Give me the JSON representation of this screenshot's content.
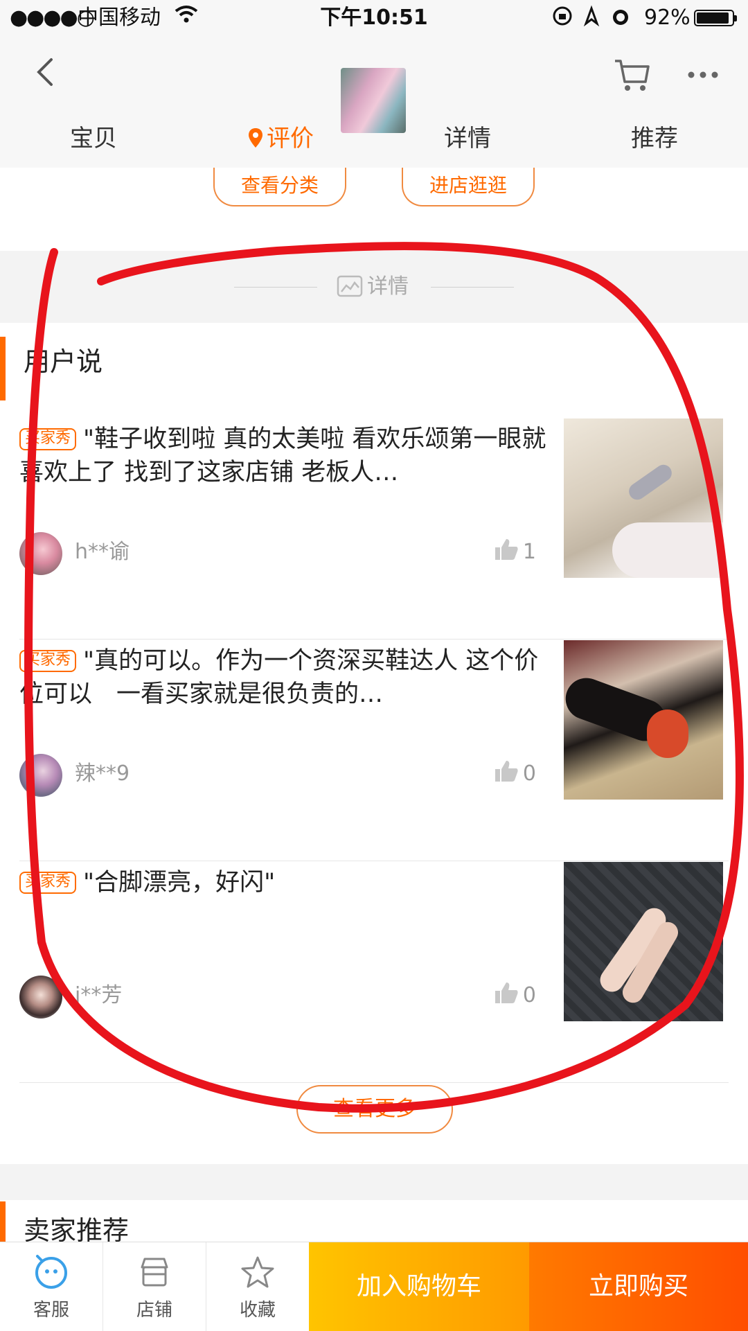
{
  "status_bar": {
    "signal": "●●●●○",
    "carrier": "中国移动",
    "time": "下午10:51",
    "battery": "92%",
    "battery_level": 0.92
  },
  "nav": {
    "tabs": [
      {
        "label": "宝贝",
        "active": false
      },
      {
        "label": "评价",
        "active": true
      },
      {
        "label": "详情",
        "active": false
      },
      {
        "label": "推荐",
        "active": false
      }
    ],
    "icons": [
      "back-icon",
      "cart-icon",
      "more-icon",
      "location-pin-icon"
    ]
  },
  "shop_buttons": {
    "view_categories": "查看分类",
    "visit_store": "进店逛逛"
  },
  "details_divider": {
    "label": "详情"
  },
  "user_reviews": {
    "title": "用户说",
    "items": [
      {
        "tag": "买家秀",
        "text": "\"鞋子收到啦 真的太美啦 看欢乐颂第一眼就喜欢上了 找到了这家店铺 老板人…",
        "user": "h**谕",
        "likes": "1"
      },
      {
        "tag": "买家秀",
        "text": "\"真的可以。作为一个资深买鞋达人 这个价位可以　一看买家就是很负责的…",
        "user": "辣**9",
        "likes": "0"
      },
      {
        "tag": "买家秀",
        "text": "\"合脚漂亮，好闪\"",
        "user": "j**芳",
        "likes": "0"
      }
    ],
    "view_more": "查看更多"
  },
  "seller_recommend": {
    "title": "卖家推荐"
  },
  "bottom_bar": {
    "service": "客服",
    "store": "店铺",
    "favorite": "收藏",
    "add_to_cart": "加入购物车",
    "buy_now": "立即购买"
  },
  "colors": {
    "accent": "#ff6a00",
    "cart_button": "#ffb000",
    "buy_button": "#ff5a00",
    "annotation": "#e8141c"
  }
}
